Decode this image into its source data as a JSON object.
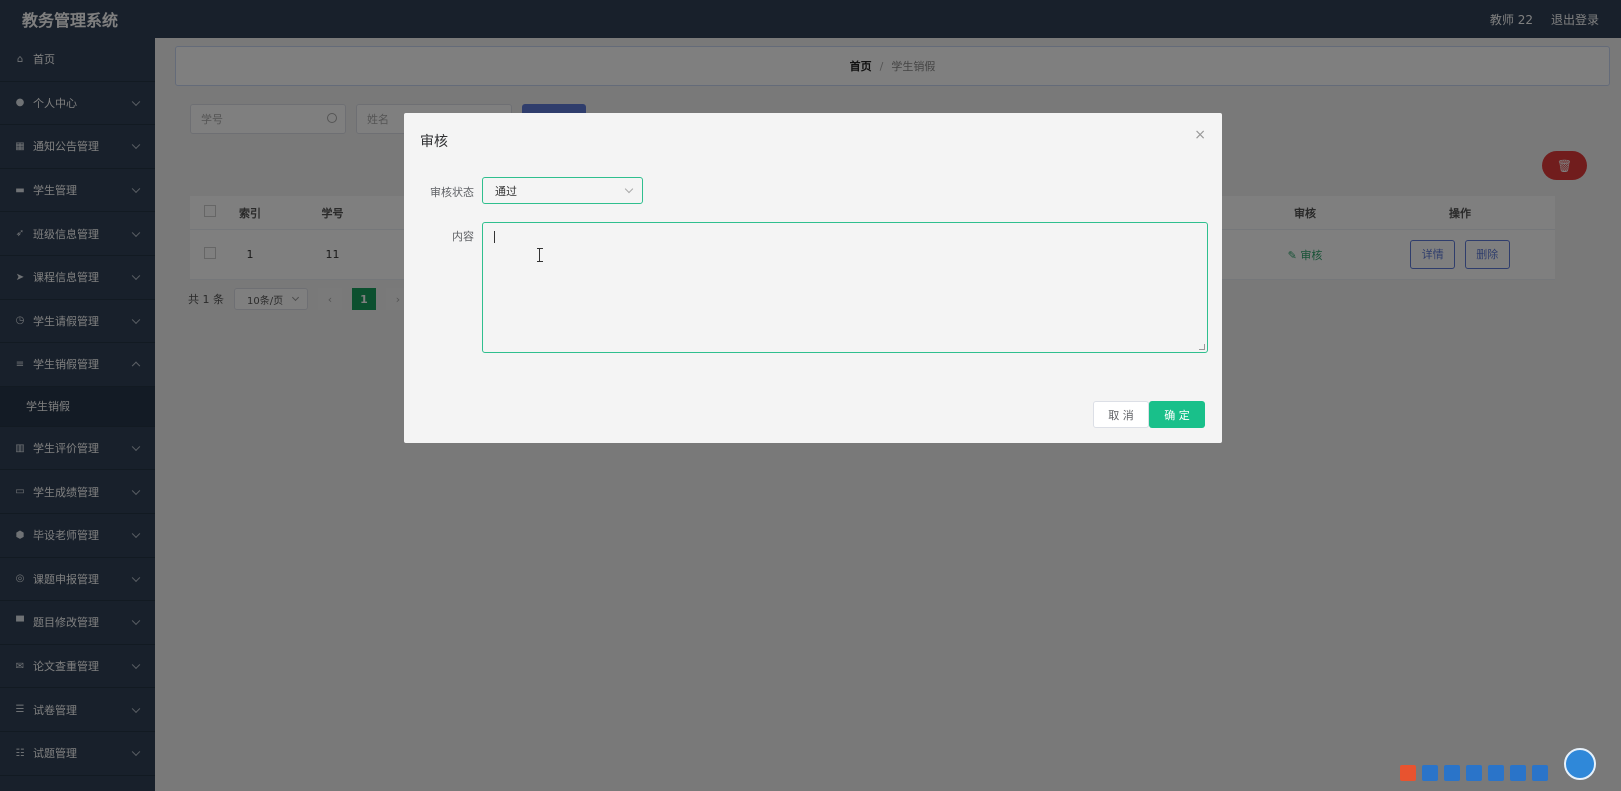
{
  "header": {
    "title": "教务管理系统",
    "user": "教师 22",
    "logout": "退出登录"
  },
  "sidebar": {
    "items": [
      {
        "label": "首页",
        "icon": "home-icon",
        "expandable": false
      },
      {
        "label": "个人中心",
        "icon": "user-icon",
        "expandable": true
      },
      {
        "label": "通知公告管理",
        "icon": "grid-icon",
        "expandable": true
      },
      {
        "label": "学生管理",
        "icon": "chat-icon",
        "expandable": true
      },
      {
        "label": "班级信息管理",
        "icon": "send-icon",
        "expandable": true
      },
      {
        "label": "课程信息管理",
        "icon": "paper-plane-icon",
        "expandable": true
      },
      {
        "label": "学生请假管理",
        "icon": "clock-icon",
        "expandable": true
      },
      {
        "label": "学生销假管理",
        "icon": "menu-icon",
        "expandable": true,
        "open": true
      },
      {
        "label": "学生评价管理",
        "icon": "bar-chart-icon",
        "expandable": true
      },
      {
        "label": "学生成绩管理",
        "icon": "message-icon",
        "expandable": true
      },
      {
        "label": "毕设老师管理",
        "icon": "shield-icon",
        "expandable": true
      },
      {
        "label": "课题申报管理",
        "icon": "compass-icon",
        "expandable": true
      },
      {
        "label": "题目修改管理",
        "icon": "monitor-icon",
        "expandable": true
      },
      {
        "label": "论文查重管理",
        "icon": "mail-icon",
        "expandable": true
      },
      {
        "label": "试卷管理",
        "icon": "list-icon",
        "expandable": true
      },
      {
        "label": "试题管理",
        "icon": "sliders-icon",
        "expandable": true
      }
    ],
    "subitem": "学生销假"
  },
  "breadcrumb": {
    "home": "首页",
    "separator": "/",
    "current": "学生销假"
  },
  "search": {
    "student_no_placeholder": "学号",
    "name_placeholder": "姓名"
  },
  "table": {
    "headers": [
      "索引",
      "学号",
      "审核",
      "操作"
    ],
    "row": {
      "index": "1",
      "student_no": "11",
      "audit_link": "审核",
      "detail_btn": "详情",
      "delete_btn": "删除"
    }
  },
  "pagination": {
    "total": "共 1 条",
    "page_size": "10条/页",
    "current_page": "1",
    "prev": "‹",
    "next": "›"
  },
  "dialog": {
    "title": "审核",
    "close": "×",
    "status_label": "审核状态",
    "status_value": "通过",
    "content_label": "内容",
    "content_value": "",
    "cancel": "取 消",
    "confirm": "确 定"
  },
  "colors": {
    "sidebar": "#304156",
    "primary": "#19c08a",
    "accent": "#5f7bd8",
    "danger": "#e23b3b"
  }
}
